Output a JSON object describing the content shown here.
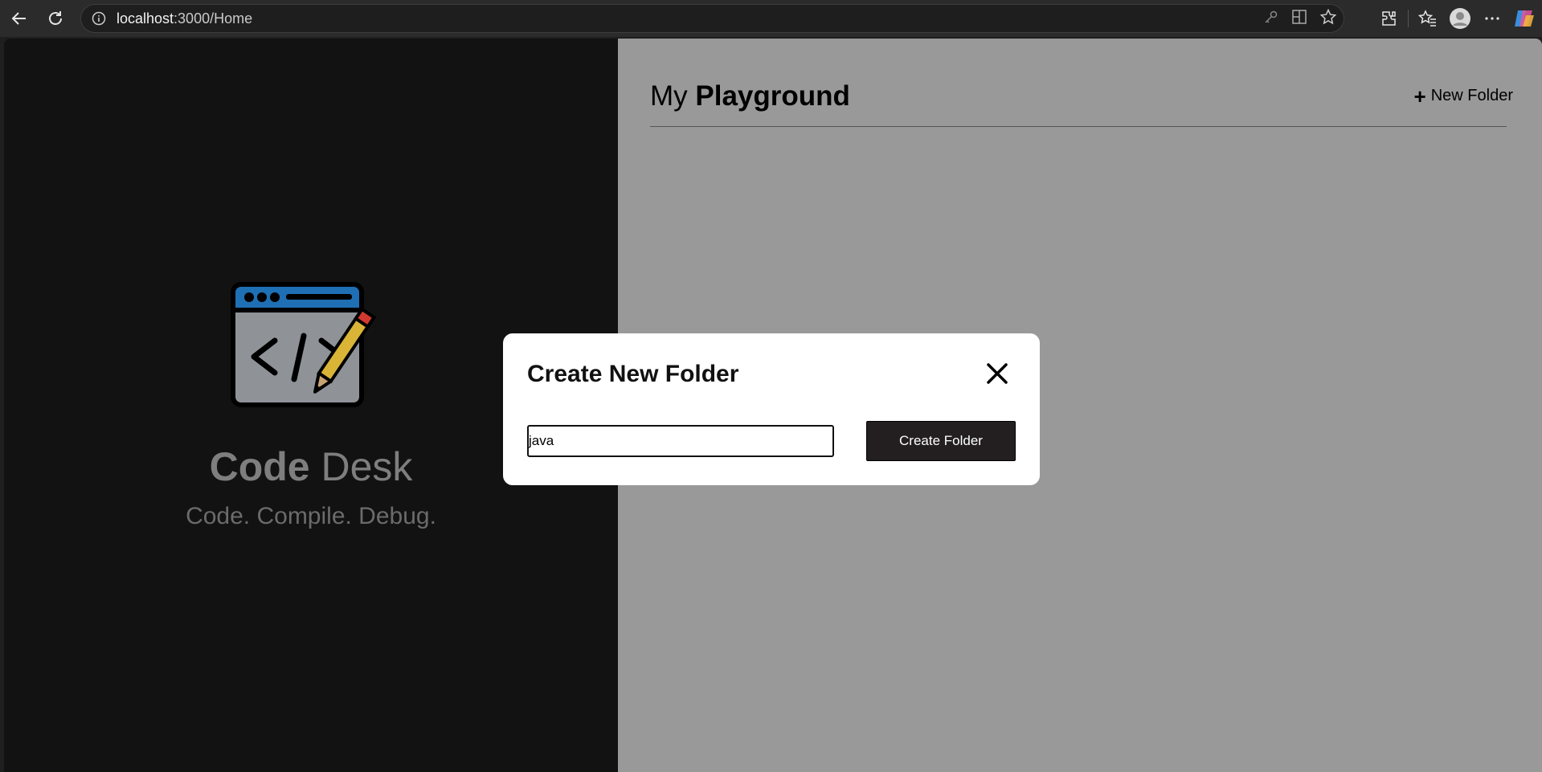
{
  "browser": {
    "url_host": "localhost",
    "url_path": ":3000/Home"
  },
  "brand": {
    "title_bold": "Code",
    "title_rest": " Desk",
    "tagline": "Code. Compile. Debug."
  },
  "playground": {
    "title_light": "My ",
    "title_bold": "Playground",
    "new_folder_label": "New Folder"
  },
  "modal": {
    "title": "Create New Folder",
    "input_value": "java",
    "submit_label": "Create Folder"
  },
  "colors": {
    "left_panel": "#121212",
    "right_panel": "#999999",
    "button": "#231f20",
    "logo_bar": "#1f6fb4",
    "pencil": "#d9b437"
  }
}
